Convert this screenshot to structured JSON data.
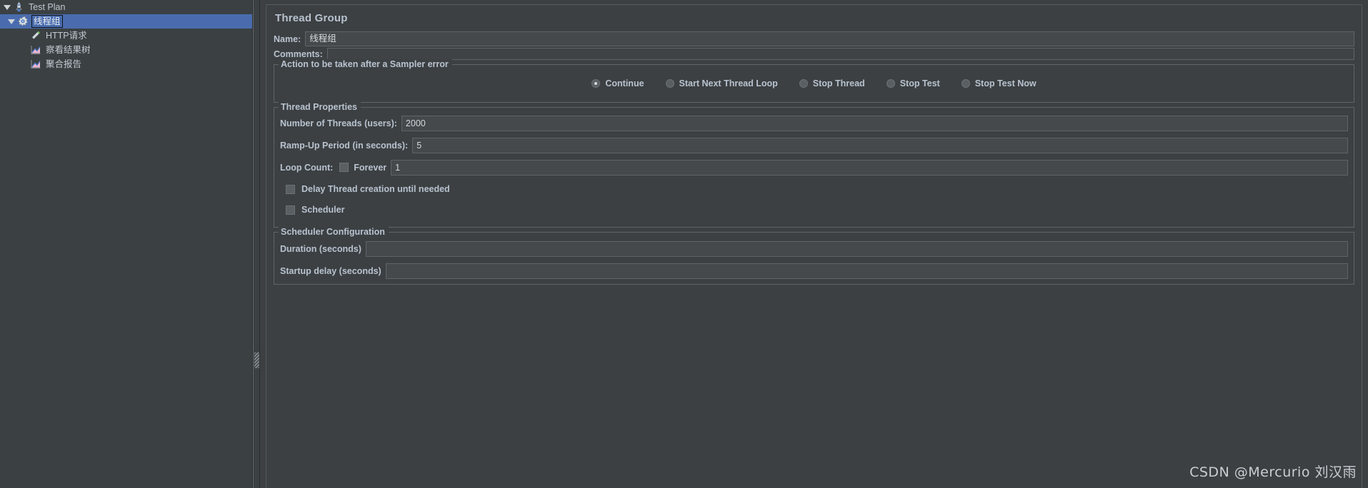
{
  "tree": {
    "nodes": [
      {
        "label": "Test Plan",
        "icon": "rocket-icon",
        "depth": 0,
        "expanded": true,
        "selected": false,
        "editing": false
      },
      {
        "label": "线程组",
        "icon": "gear-icon",
        "depth": 1,
        "expanded": true,
        "selected": true,
        "editing": true
      },
      {
        "label": "HTTP请求",
        "icon": "pen-icon",
        "depth": 2,
        "expanded": null,
        "selected": false,
        "editing": false
      },
      {
        "label": "察看结果树",
        "icon": "chart-view-icon",
        "depth": 2,
        "expanded": null,
        "selected": false,
        "editing": false
      },
      {
        "label": "聚合报告",
        "icon": "chart-report-icon",
        "depth": 2,
        "expanded": null,
        "selected": false,
        "editing": false
      }
    ]
  },
  "splitter": {
    "grip_name": "splitter-grip"
  },
  "panel": {
    "title": "Thread Group",
    "name_label": "Name:",
    "name_value": "线程组",
    "comments_label": "Comments:",
    "comments_value": "",
    "sampler_error": {
      "group_title": "Action to be taken after a Sampler error",
      "options": [
        {
          "label": "Continue",
          "checked": true
        },
        {
          "label": "Start Next Thread Loop",
          "checked": false
        },
        {
          "label": "Stop Thread",
          "checked": false
        },
        {
          "label": "Stop Test",
          "checked": false
        },
        {
          "label": "Stop Test Now",
          "checked": false
        }
      ]
    },
    "thread_properties": {
      "group_title": "Thread Properties",
      "num_threads_label": "Number of Threads (users):",
      "num_threads_value": "2000",
      "ramp_up_label": "Ramp-Up Period (in seconds):",
      "ramp_up_value": "5",
      "loop_count_label": "Loop Count:",
      "forever_label": "Forever",
      "forever_checked": false,
      "loop_count_value": "1",
      "delay_thread_label": "Delay Thread creation until needed",
      "delay_thread_checked": false,
      "scheduler_label": "Scheduler",
      "scheduler_checked": false
    },
    "scheduler_configuration": {
      "group_title": "Scheduler Configuration",
      "duration_label": "Duration (seconds)",
      "duration_value": "",
      "startup_delay_label": "Startup delay (seconds)",
      "startup_delay_value": ""
    }
  },
  "watermark": "CSDN @Mercurio 刘汉雨",
  "colors": {
    "background": "#3c4043",
    "selection": "#4a6cae",
    "text": "#b9c3cf",
    "field_bg": "#45494c",
    "border": "#5e6468"
  }
}
